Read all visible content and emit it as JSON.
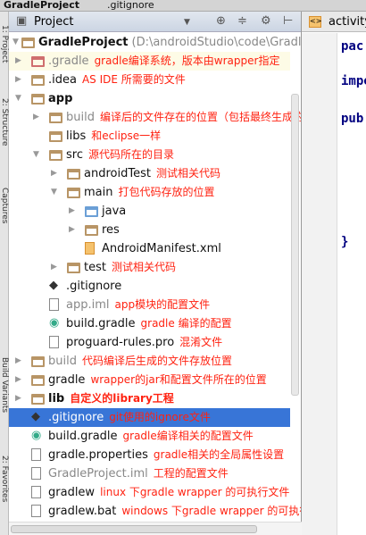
{
  "window": {
    "project_tab": "GradleProject",
    "file_tab": ".gitignore"
  },
  "side_tools": [
    "1: Project",
    "2: Structure",
    "Captures",
    "Build Variants",
    "2: Favorites"
  ],
  "panel": {
    "view_label": "Project",
    "icons": [
      "locate-icon",
      "collapse-icon",
      "gear-icon",
      "hide-icon"
    ]
  },
  "editor": {
    "tab": "activity_",
    "lines": [
      "pac",
      "impo",
      "pub",
      "}"
    ]
  },
  "tree": [
    {
      "level": 0,
      "arrow": "down",
      "icon": "project",
      "name": "GradleProject",
      "bold": true,
      "path": "(D:\\androidStudio\\code\\GradleP",
      "note": ""
    },
    {
      "level": 1,
      "arrow": "right",
      "icon": "folder-red",
      "name": ".gradle",
      "gray": true,
      "note": "gradle编译系统，版本由wrapper指定",
      "hl": true
    },
    {
      "level": 1,
      "arrow": "right",
      "icon": "folder",
      "name": ".idea",
      "note": "AS IDE 所需要的文件"
    },
    {
      "level": 1,
      "arrow": "down",
      "icon": "module",
      "name": "app",
      "bold": true,
      "note": ""
    },
    {
      "level": 2,
      "arrow": "right",
      "icon": "folder",
      "name": "build",
      "gray": true,
      "note": "编译后的文件存在的位置（包括最终生成的apk）"
    },
    {
      "level": 2,
      "arrow": "",
      "icon": "folder",
      "name": "libs",
      "note": "和eclipse一样"
    },
    {
      "level": 2,
      "arrow": "down",
      "icon": "folder",
      "name": "src",
      "note": "源代码所在的目录"
    },
    {
      "level": 3,
      "arrow": "right",
      "icon": "folder",
      "name": "androidTest",
      "note": "测试相关代码"
    },
    {
      "level": 3,
      "arrow": "down",
      "icon": "folder",
      "name": "main",
      "note": "打包代码存放的位置"
    },
    {
      "level": 4,
      "arrow": "right",
      "icon": "folder-blue",
      "name": "java",
      "note": ""
    },
    {
      "level": 4,
      "arrow": "right",
      "icon": "folder",
      "name": "res",
      "note": ""
    },
    {
      "level": 4,
      "arrow": "",
      "icon": "xml",
      "name": "AndroidManifest.xml",
      "note": ""
    },
    {
      "level": 3,
      "arrow": "right",
      "icon": "folder",
      "name": "test",
      "note": "测试相关代码"
    },
    {
      "level": 2,
      "arrow": "",
      "icon": "git",
      "name": ".gitignore",
      "note": ""
    },
    {
      "level": 2,
      "arrow": "",
      "icon": "file",
      "name": "app.iml",
      "gray": true,
      "note": "app模块的配置文件"
    },
    {
      "level": 2,
      "arrow": "",
      "icon": "gradle",
      "name": "build.gradle",
      "note": "gradle 编译的配置"
    },
    {
      "level": 2,
      "arrow": "",
      "icon": "file",
      "name": "proguard-rules.pro",
      "note": "混淆文件"
    },
    {
      "level": 1,
      "arrow": "right",
      "icon": "folder",
      "name": "build",
      "gray": true,
      "note": "代码编译后生成的文件存放位置"
    },
    {
      "level": 1,
      "arrow": "right",
      "icon": "folder",
      "name": "gradle",
      "note": "wrapper的jar和配置文件所在的位置"
    },
    {
      "level": 1,
      "arrow": "right",
      "icon": "lib",
      "name": "lib",
      "bold": true,
      "note": "自定义的library工程"
    },
    {
      "level": 1,
      "arrow": "",
      "icon": "git",
      "name": ".gitignore",
      "note": "git使用的ignore文件",
      "selected": true
    },
    {
      "level": 1,
      "arrow": "",
      "icon": "gradle",
      "name": "build.gradle",
      "note": "gradle编译相关的配置文件"
    },
    {
      "level": 1,
      "arrow": "",
      "icon": "props",
      "name": "gradle.properties",
      "note": "gradle相关的全局属性设置"
    },
    {
      "level": 1,
      "arrow": "",
      "icon": "file",
      "name": "GradleProject.iml",
      "gray": true,
      "note": "工程的配置文件"
    },
    {
      "level": 1,
      "arrow": "",
      "icon": "file",
      "name": "gradlew",
      "note": "linux 下gradle wrapper 的可执行文件"
    },
    {
      "level": 1,
      "arrow": "",
      "icon": "file",
      "name": "gradlew.bat",
      "note": "windows 下gradle wrapper 的可执行文件"
    }
  ],
  "colors": {
    "selection": "#3875d7",
    "annotation": "#ff2211",
    "keyword": "#000080"
  }
}
